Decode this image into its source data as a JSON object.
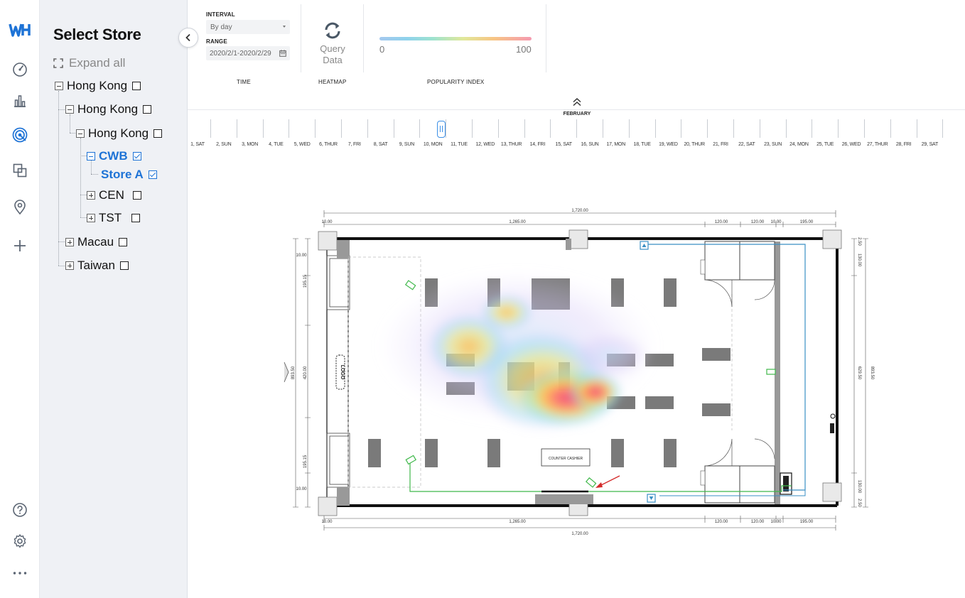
{
  "sidebar": {
    "logo": "brand-logo",
    "icons": [
      "dashboard-icon",
      "bar-chart-icon",
      "heatmap-icon",
      "layers-icon",
      "location-pin-icon",
      "add-icon",
      "help-icon",
      "settings-icon",
      "more-icon"
    ],
    "active": "heatmap-icon"
  },
  "store_tree": {
    "title": "Select Store",
    "expand_all": "Expand all",
    "nodes": [
      {
        "label": "Hong Kong",
        "level": 0,
        "expanded": true,
        "checked": false
      },
      {
        "label": "Hong Kong",
        "level": 1,
        "expanded": true,
        "checked": false
      },
      {
        "label": "Hong Kong",
        "level": 2,
        "expanded": true,
        "checked": false
      },
      {
        "label": "CWB",
        "level": 3,
        "expanded": true,
        "checked": true,
        "selected": true
      },
      {
        "label": "Store A",
        "level": 4,
        "checked": true,
        "selected": true
      },
      {
        "label": "CEN",
        "level": 3,
        "expanded": false,
        "checked": false
      },
      {
        "label": "TST",
        "level": 3,
        "expanded": false,
        "checked": false
      },
      {
        "label": "Macau",
        "level": 1,
        "expanded": false,
        "checked": false
      },
      {
        "label": "Taiwan",
        "level": 1,
        "expanded": false,
        "checked": false
      }
    ]
  },
  "controls": {
    "interval_label": "INTERVAL",
    "interval_value": "By day",
    "range_label": "RANGE",
    "range_value": "2020/2/1-2020/2/29",
    "query_line1": "Query",
    "query_line2": "Data",
    "legend_min": "0",
    "legend_max": "100",
    "section_time": "TIME",
    "section_heatmap": "HEATMAP",
    "section_popularity": "POPULARITY INDEX"
  },
  "timeline": {
    "month": "FEBRUARY",
    "selected_day": 10,
    "days": [
      "1, SAT",
      "2, SUN",
      "3, MON",
      "4, TUE",
      "5, WED",
      "6, THUR",
      "7, FRI",
      "8, SAT",
      "9, SUN",
      "10, MON",
      "11, TUE",
      "12, WED",
      "13, THUR",
      "14, FRI",
      "15, SAT",
      "16, SUN",
      "17, MON",
      "18, TUE",
      "19, WED",
      "20, THUR",
      "21, FRI",
      "22, SAT",
      "23, SUN",
      "24, MON",
      "25, TUE",
      "26, WED",
      "27, THUR",
      "28, FRI",
      "29, SAT"
    ]
  },
  "floorplan": {
    "dimensions": {
      "top_total": "1,720.00",
      "top_left": "1,265.00",
      "top_a": "120.00",
      "top_b": "120.00",
      "top_c": "10.00",
      "top_d": "195.00",
      "top_small": "10.00",
      "bottom_total": "1,720.00",
      "bottom_left": "1,265.00",
      "bottom_a": "120.00",
      "bottom_b": "120.00",
      "bottom_c": "10.00",
      "bottom_d": "195.00",
      "bottom_small": "10.00",
      "left_outer": "893.50",
      "left_a": "195.15",
      "left_b": "420.00",
      "left_c": "195.15",
      "left_small_top": "10.00",
      "left_small_bot": "10.00",
      "right_outer": "893.50",
      "right_a": "130.00",
      "right_b": "629.50",
      "right_c": "130.00",
      "right_small_top": "2.50",
      "right_small_bot": "2.50"
    },
    "counter_label": "COUNTER CASHIER",
    "logo_label": "LOGO"
  },
  "colors": {
    "accent": "#1e73d6",
    "heat_high": "#f0467a",
    "heat_mid": "#ffb84a",
    "heat_low": "#6fd3f0",
    "sensor_green": "#3fb84a",
    "sensor_blue": "#3a8fc4"
  }
}
